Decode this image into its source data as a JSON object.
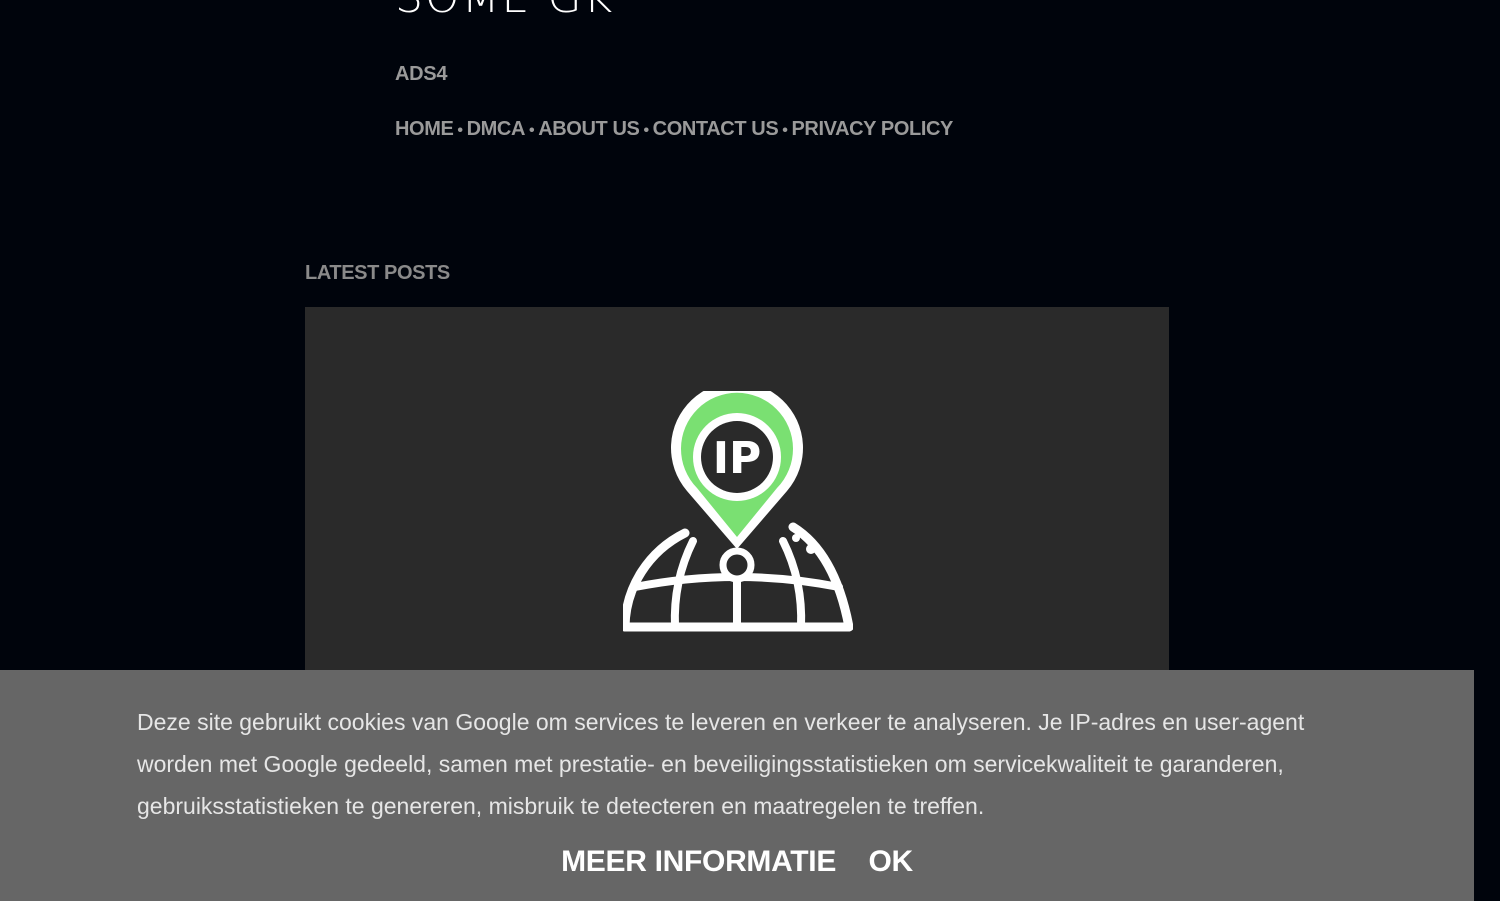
{
  "header": {
    "site_title": "SOME GK",
    "site_description": "ADS4"
  },
  "nav": {
    "items": [
      "HOME",
      "DMCA",
      "ABOUT US",
      "CONTACT US",
      "PRIVACY POLICY"
    ],
    "separator": "•"
  },
  "main": {
    "section_heading": "LATEST POSTS",
    "post_thumbnail_icon": "ip-location-pin-globe-icon",
    "icon_label": "IP"
  },
  "cookie_notice": {
    "text": "Deze site gebruikt cookies van Google om services te leveren en verkeer te analyseren. Je IP-adres en user-agent worden met Google gedeeld, samen met prestatie- en beveiligingsstatistieken om servicekwaliteit te garanderen, gebruiksstatistieken te genereren, misbruik te detecteren en maatregelen te treffen.",
    "more_info_label": "MEER INFORMATIE",
    "ok_label": "OK"
  },
  "colors": {
    "page_background": "#00040c",
    "card_background": "#2a2a2a",
    "cookie_background": "#666666",
    "icon_green": "#7ae072",
    "muted_text": "#9a9a9a"
  }
}
